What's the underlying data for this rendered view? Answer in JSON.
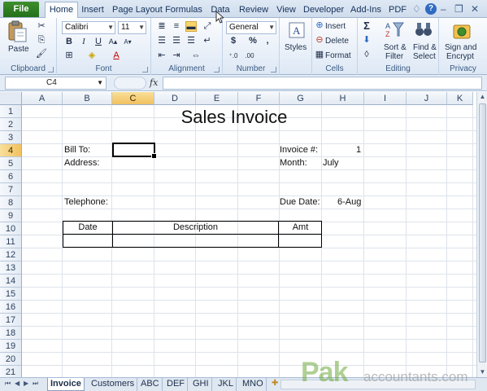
{
  "tabs": [
    "File",
    "Home",
    "Insert",
    "Page Layout",
    "Formulas",
    "Data",
    "Review",
    "View",
    "Developer",
    "Add-Ins",
    "PDF"
  ],
  "ribbon": {
    "clipboard": {
      "paste_label": "Paste",
      "group_label": "Clipboard"
    },
    "font": {
      "family": "Calibri",
      "size": "11",
      "group_label": "Font",
      "bold": "B",
      "italic": "I",
      "underline": "U"
    },
    "alignment": {
      "group_label": "Alignment"
    },
    "number": {
      "format": "General",
      "group_label": "Number",
      "currency": "$",
      "percent": "%",
      "comma": ","
    },
    "styles": {
      "label": "Styles"
    },
    "cells": {
      "insert": "Insert",
      "delete": "Delete",
      "format": "Format",
      "group_label": "Cells"
    },
    "editing": {
      "sort_filter_1": "Sort &",
      "sort_filter_2": "Filter",
      "find_select_1": "Find &",
      "find_select_2": "Select",
      "group_label": "Editing",
      "sum": "Σ"
    },
    "privacy": {
      "sign_1": "Sign and",
      "sign_2": "Encrypt",
      "group_label": "Privacy"
    }
  },
  "formula_bar": {
    "name_box": "C4",
    "fx": "fx",
    "content": ""
  },
  "grid": {
    "columns": [
      "A",
      "B",
      "C",
      "D",
      "E",
      "F",
      "G",
      "H",
      "I",
      "J",
      "K"
    ],
    "rows": [
      "1",
      "2",
      "3",
      "4",
      "5",
      "6",
      "7",
      "8",
      "9",
      "10",
      "11",
      "12",
      "13",
      "14",
      "15",
      "16",
      "17",
      "18",
      "19",
      "20",
      "21"
    ],
    "title": "Sales Invoice",
    "bill_to": "Bill To:",
    "address": "Address:",
    "telephone": "Telephone:",
    "invoice_no_label": "Invoice #:",
    "invoice_no_value": "1",
    "month_label": "Month:",
    "month_value": "July",
    "due_date_label": "Due Date:",
    "due_date_value": "6-Aug",
    "table_headers": [
      "Date",
      "Description",
      "Amt"
    ]
  },
  "sheets": [
    "Invoice",
    "Customers",
    "ABC",
    "DEF",
    "GHI",
    "JKL",
    "MNO"
  ],
  "watermark": {
    "brand": "Pak",
    "rest": "accountants.com"
  },
  "colors": {
    "file_tab": "#2e7d22",
    "selected_header": "#f5c96b",
    "grid_line": "#dde3ea",
    "accent": "#2f6bc2"
  }
}
